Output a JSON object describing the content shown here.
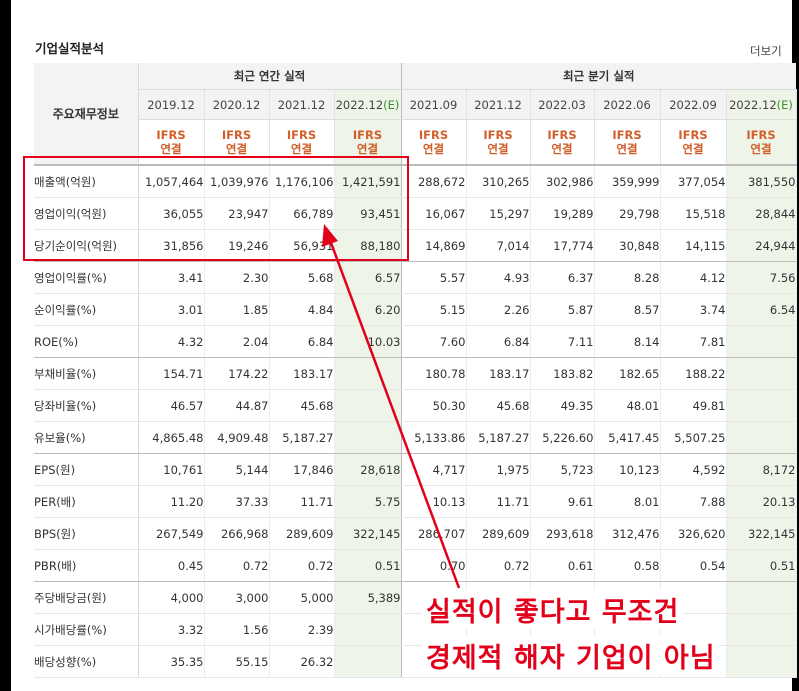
{
  "section": {
    "title": "기업실적분석",
    "more_link": "더보기"
  },
  "table": {
    "corner_label": "주요재무정보",
    "groups": {
      "annual": "최근 연간 실적",
      "quarterly": "최근 분기 실적"
    },
    "periods": [
      {
        "date": "2019.12",
        "estimate": ""
      },
      {
        "date": "2020.12",
        "estimate": ""
      },
      {
        "date": "2021.12",
        "estimate": ""
      },
      {
        "date": "2022.12",
        "estimate": "(E)"
      },
      {
        "date": "2021.09",
        "estimate": ""
      },
      {
        "date": "2021.12",
        "estimate": ""
      },
      {
        "date": "2022.03",
        "estimate": ""
      },
      {
        "date": "2022.06",
        "estimate": ""
      },
      {
        "date": "2022.09",
        "estimate": ""
      },
      {
        "date": "2022.12",
        "estimate": "(E)"
      }
    ],
    "standard": "IFRS",
    "basis": "연결",
    "rows": [
      {
        "label": "매출액(억원)",
        "values": [
          "1,057,464",
          "1,039,976",
          "1,176,106",
          "1,421,591",
          "288,672",
          "310,265",
          "302,986",
          "359,999",
          "377,054",
          "381,550"
        ]
      },
      {
        "label": "영업이익(억원)",
        "values": [
          "36,055",
          "23,947",
          "66,789",
          "93,451",
          "16,067",
          "15,297",
          "19,289",
          "29,798",
          "15,518",
          "28,844"
        ]
      },
      {
        "label": "당기순이익(억원)",
        "values": [
          "31,856",
          "19,246",
          "56,931",
          "88,180",
          "14,869",
          "7,014",
          "17,774",
          "30,848",
          "14,115",
          "24,944"
        ]
      },
      {
        "label": "영업이익률(%)",
        "values": [
          "3.41",
          "2.30",
          "5.68",
          "6.57",
          "5.57",
          "4.93",
          "6.37",
          "8.28",
          "4.12",
          "7.56"
        ]
      },
      {
        "label": "순이익률(%)",
        "values": [
          "3.01",
          "1.85",
          "4.84",
          "6.20",
          "5.15",
          "2.26",
          "5.87",
          "8.57",
          "3.74",
          "6.54"
        ]
      },
      {
        "label": "ROE(%)",
        "values": [
          "4.32",
          "2.04",
          "6.84",
          "10.03",
          "7.60",
          "6.84",
          "7.11",
          "8.14",
          "7.81",
          ""
        ]
      },
      {
        "label": "부채비율(%)",
        "values": [
          "154.71",
          "174.22",
          "183.17",
          "",
          "180.78",
          "183.17",
          "183.82",
          "182.65",
          "188.22",
          ""
        ]
      },
      {
        "label": "당좌비율(%)",
        "values": [
          "46.57",
          "44.87",
          "45.68",
          "",
          "50.30",
          "45.68",
          "49.35",
          "48.01",
          "49.81",
          ""
        ]
      },
      {
        "label": "유보율(%)",
        "values": [
          "4,865.48",
          "4,909.48",
          "5,187.27",
          "",
          "5,133.86",
          "5,187.27",
          "5,226.60",
          "5,417.45",
          "5,507.25",
          ""
        ]
      },
      {
        "label": "EPS(원)",
        "values": [
          "10,761",
          "5,144",
          "17,846",
          "28,618",
          "4,717",
          "1,975",
          "5,723",
          "10,123",
          "4,592",
          "8,172"
        ]
      },
      {
        "label": "PER(배)",
        "values": [
          "11.20",
          "37.33",
          "11.71",
          "5.75",
          "10.13",
          "11.71",
          "9.61",
          "8.01",
          "7.88",
          "20.13"
        ]
      },
      {
        "label": "BPS(원)",
        "values": [
          "267,549",
          "266,968",
          "289,609",
          "322,145",
          "286,707",
          "289,609",
          "293,618",
          "312,476",
          "326,620",
          "322,145"
        ]
      },
      {
        "label": "PBR(배)",
        "values": [
          "0.45",
          "0.72",
          "0.72",
          "0.51",
          "0.70",
          "0.72",
          "0.61",
          "0.58",
          "0.54",
          "0.51"
        ]
      },
      {
        "label": "주당배당금(원)",
        "values": [
          "4,000",
          "3,000",
          "5,000",
          "5,389",
          "",
          "",
          "",
          "",
          "",
          ""
        ]
      },
      {
        "label": "시가배당률(%)",
        "values": [
          "3.32",
          "1.56",
          "2.39",
          "",
          "",
          "",
          "",
          "",
          "",
          ""
        ]
      },
      {
        "label": "배당성향(%)",
        "values": [
          "35.35",
          "55.15",
          "26.32",
          "",
          "",
          "",
          "",
          "",
          "",
          ""
        ]
      }
    ]
  },
  "annotation": {
    "line1": "실적이 좋다고 무조건",
    "line2": "경제적 해자 기업이 아님",
    "color": "#e2001a"
  }
}
